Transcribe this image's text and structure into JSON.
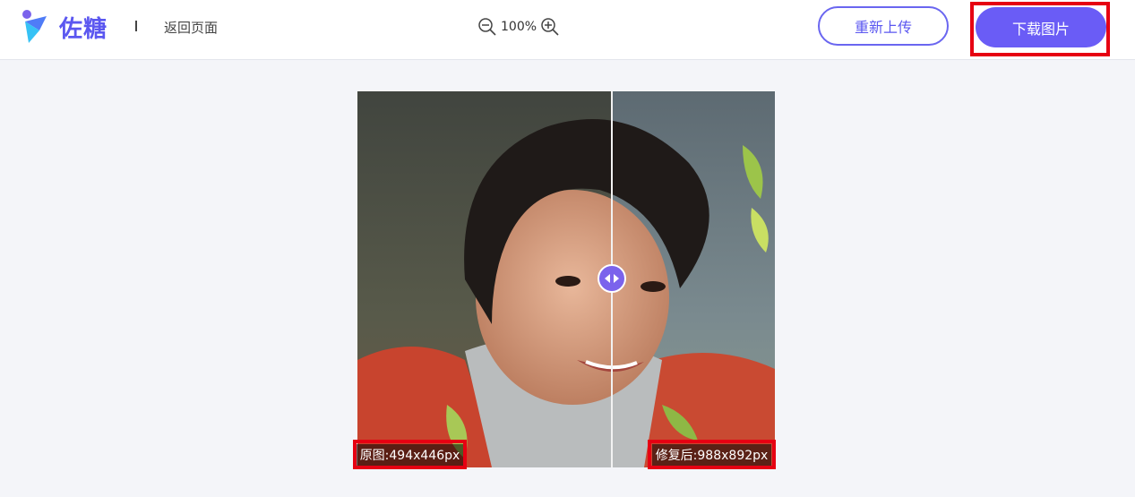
{
  "brand": {
    "name": "佐糖",
    "accent": "#5b57f0",
    "logo_icon": "zuotang-logo-icon"
  },
  "header": {
    "back_label": "返回页面",
    "zoom": {
      "value": "100%",
      "zoom_out_icon": "zoom-out-icon",
      "zoom_in_icon": "zoom-in-icon"
    },
    "reupload_label": "重新上传",
    "download_label": "下载图片"
  },
  "compare": {
    "original_label": "原图:494x446px",
    "restored_label": "修复后:988x892px",
    "handle_icon": "left-right-arrows-icon"
  },
  "colors": {
    "highlight": "#e60012",
    "button_primary": "#6a5cf6",
    "background": "#f4f5f9"
  }
}
